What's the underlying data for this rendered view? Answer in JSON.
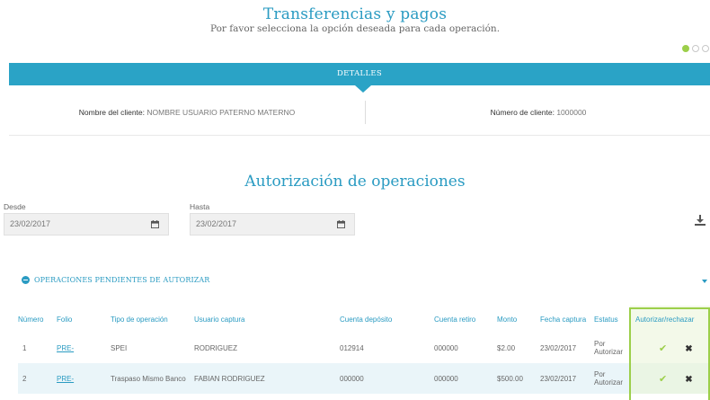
{
  "header": {
    "title": "Transferencias y pagos",
    "subtitle": "Por favor selecciona la opción deseada para cada operación."
  },
  "details": {
    "bar_label": "DETALLES",
    "client_name_label": "Nombre del cliente:",
    "client_name_value": "NOMBRE USUARIO PATERNO MATERNO",
    "client_number_label": "Número de cliente:",
    "client_number_value": "1000000"
  },
  "section": {
    "title": "Autorización de operaciones"
  },
  "filters": {
    "desde_label": "Desde",
    "desde_value": "23/02/2017",
    "hasta_label": "Hasta",
    "hasta_value": "23/02/2017"
  },
  "pending": {
    "title": "OPERACIONES PENDIENTES DE AUTORIZAR"
  },
  "table": {
    "headers": {
      "numero": "Número",
      "folio": "Folio",
      "tipo": "Tipo de operación",
      "usuario": "Usuario captura",
      "cuenta_deposito": "Cuenta depósito",
      "cuenta_retiro": "Cuenta retiro",
      "monto": "Monto",
      "fecha": "Fecha captura",
      "estatus": "Estatus",
      "autorizar": "Autorizar/rechazar"
    },
    "rows": [
      {
        "numero": "1",
        "folio": "PRE-",
        "tipo": "SPEI",
        "usuario": "RODRIGUEZ",
        "cuenta_deposito": "012914",
        "cuenta_retiro": "000000",
        "monto": "$2.00",
        "fecha": "23/02/2017",
        "estatus": "Por Autorizar"
      },
      {
        "numero": "2",
        "folio": "PRE-",
        "tipo": "Traspaso Mismo Banco",
        "usuario": "FABIAN RODRIGUEZ",
        "cuenta_deposito": "000000",
        "cuenta_retiro": "000000",
        "monto": "$500.00",
        "fecha": "23/02/2017",
        "estatus": "Por Autorizar"
      }
    ]
  },
  "icons": {
    "calendar": "calendar-icon",
    "download": "download-icon",
    "approve": "check-icon",
    "reject": "close-icon"
  },
  "colors": {
    "accent": "#2aa3c6",
    "approve": "#9ccf4a"
  }
}
